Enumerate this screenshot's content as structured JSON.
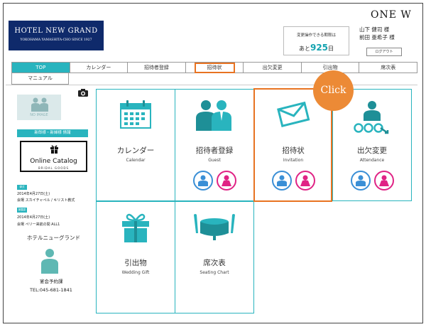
{
  "header": {
    "hotel_name": "HOTEL NEW GRAND",
    "hotel_sub": "YOKOHAMA YAMASHITA-CHO SINCE 1927",
    "brand": "ONE W",
    "deadline_label": "変更操作できる期限は",
    "deadline_prefix": "あと",
    "deadline_days": "925",
    "deadline_suffix": "日",
    "name1": "山下 健司 様",
    "name2": "前田 亜希子 様",
    "logout": "ログアウト"
  },
  "tabs": [
    {
      "label": "TOP"
    },
    {
      "label": "カレンダー"
    },
    {
      "label": "招待者登録"
    },
    {
      "label": "招待状"
    },
    {
      "label": "出欠変更"
    },
    {
      "label": "引出物"
    },
    {
      "label": "席次表"
    }
  ],
  "manual": "マニュアル",
  "sidebar": {
    "noimage": "NO IMAGE",
    "info_button": "新郎様・新婦様 情報",
    "catalog_title": "Online Catalog",
    "catalog_sub": "BRIDAL GOODS",
    "event1_tag": "挙式",
    "event1_date": "2014年4月27日(土)",
    "event1_place": "会場 スカイチャペル / キリスト教式",
    "event2_tag": "披露宴",
    "event2_date": "2014年4月27日(土)",
    "event2_place": "会場 ペリー来航の間 ALL1",
    "venue": "ホテルニューグランド",
    "contact_dept": "宴会予約課",
    "contact_tel": "TEL:045-681-1841"
  },
  "tiles": [
    {
      "title": "カレンダー",
      "en": "Calendar",
      "icon": "calendar-icon"
    },
    {
      "title": "招待者登録",
      "en": "Guest",
      "icon": "guest-icon"
    },
    {
      "title": "招待状",
      "en": "Invitation",
      "icon": "envelope-icon"
    },
    {
      "title": "出欠変更",
      "en": "Attendance",
      "icon": "attendance-icon"
    },
    {
      "title": "引出物",
      "en": "Wedding Gift",
      "icon": "gift-icon"
    },
    {
      "title": "席次表",
      "en": "Seating Chart",
      "icon": "table-icon"
    }
  ],
  "callout": "Click",
  "colors": {
    "accent": "#29b4be",
    "highlight": "#e87321",
    "groom": "#3a8fd6",
    "bride": "#e02385",
    "logo_bg": "#0f2a6b"
  }
}
